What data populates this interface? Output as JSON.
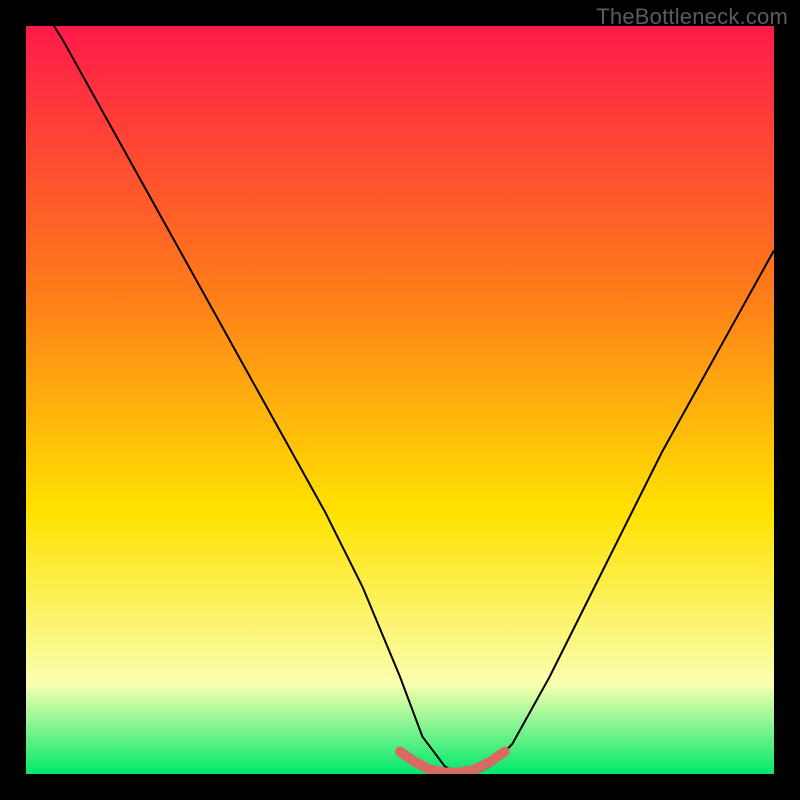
{
  "watermark": "TheBottleneck.com",
  "colors": {
    "frame": "#000000",
    "gradient_top": "#ff1a4a",
    "gradient_mid1": "#ff7a1a",
    "gradient_mid2": "#ffe200",
    "gradient_low": "#f9ffb0",
    "gradient_bottom": "#00e86b",
    "curve": "#000000",
    "accent": "#d86a64"
  },
  "chart_data": {
    "type": "line",
    "title": "",
    "xlabel": "",
    "ylabel": "",
    "xlim": [
      0,
      100
    ],
    "ylim": [
      0,
      100
    ],
    "series": [
      {
        "name": "bottleneck-curve",
        "x": [
          0,
          5,
          10,
          15,
          20,
          25,
          30,
          35,
          40,
          45,
          50,
          53,
          56,
          58,
          60,
          62,
          65,
          70,
          75,
          80,
          85,
          90,
          95,
          100
        ],
        "values": [
          106,
          98,
          89,
          80,
          71,
          62,
          53,
          44,
          35,
          25,
          13,
          5,
          1,
          0,
          0,
          1,
          4,
          13,
          23,
          33,
          43,
          52,
          61,
          70
        ]
      }
    ],
    "accent_segment": {
      "x": [
        50,
        52,
        54,
        56,
        58,
        60,
        62,
        64
      ],
      "values": [
        3.0,
        1.6,
        0.6,
        0.2,
        0.2,
        0.6,
        1.6,
        3.0
      ]
    },
    "annotations": []
  }
}
